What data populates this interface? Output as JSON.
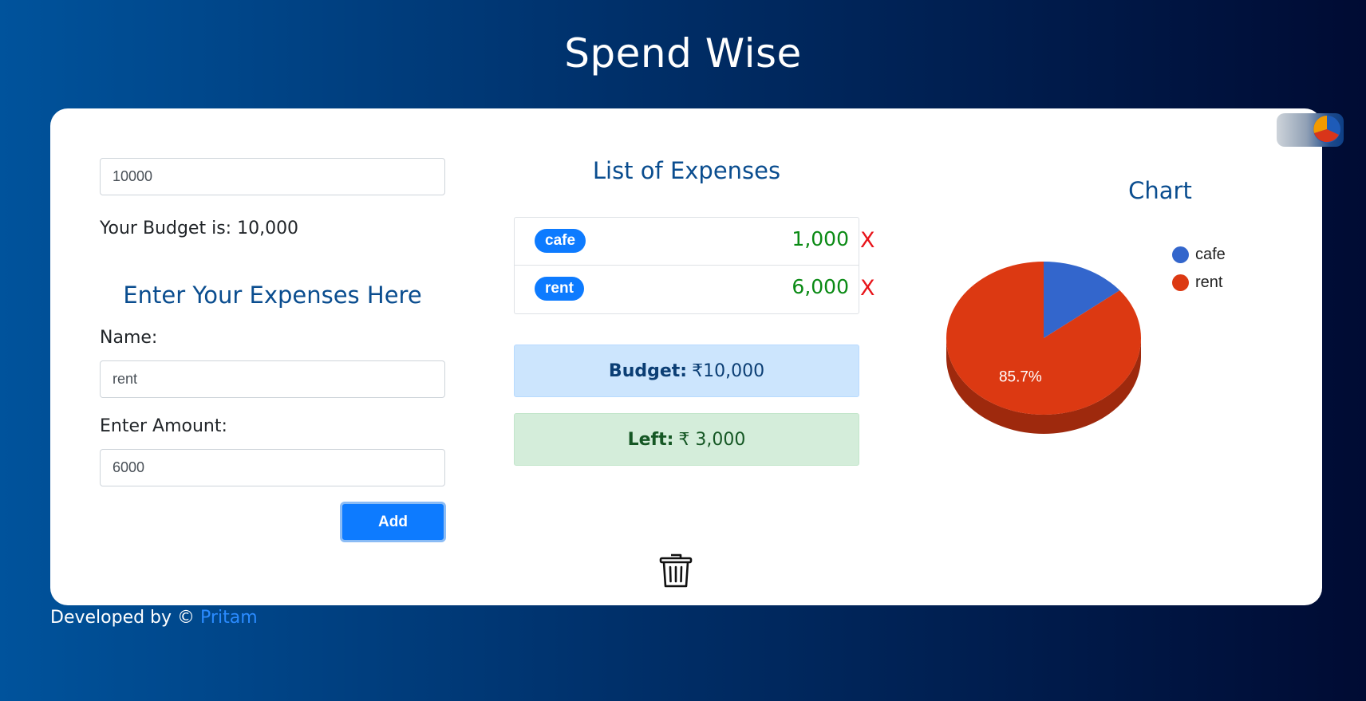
{
  "app": {
    "title": "Spend Wise"
  },
  "budget": {
    "input_value": "10000",
    "display_label": "Your Budget is:",
    "display_value": "10,000"
  },
  "expense_form": {
    "title": "Enter Your Expenses Here",
    "name_label": "Name:",
    "name_value": "rent",
    "amount_label": "Enter Amount:",
    "amount_value": "6000",
    "add_label": "Add"
  },
  "expenses": {
    "title": "List of Expenses",
    "items": [
      {
        "name": "cafe",
        "amount": "1,000",
        "delete_label": "X"
      },
      {
        "name": "rent",
        "amount": "6,000",
        "delete_label": "X"
      }
    ]
  },
  "summary": {
    "budget_label": "Budget:",
    "budget_value": "₹10,000",
    "left_label": "Left:",
    "left_value": "₹ 3,000"
  },
  "chart_section": {
    "title": "Chart"
  },
  "chart_data": {
    "type": "pie",
    "categories": [
      "cafe",
      "rent"
    ],
    "values": [
      1000,
      6000
    ],
    "slice_labels": [
      "",
      "85.7%"
    ],
    "colors": [
      "#3366cc",
      "#dc3912"
    ],
    "legend": "right",
    "style": "3d"
  },
  "footer": {
    "prefix": "Developed by ©",
    "author": "Pritam"
  },
  "icons": {
    "theme_toggle": "pie-chart-icon",
    "clear_all": "trash-icon"
  }
}
